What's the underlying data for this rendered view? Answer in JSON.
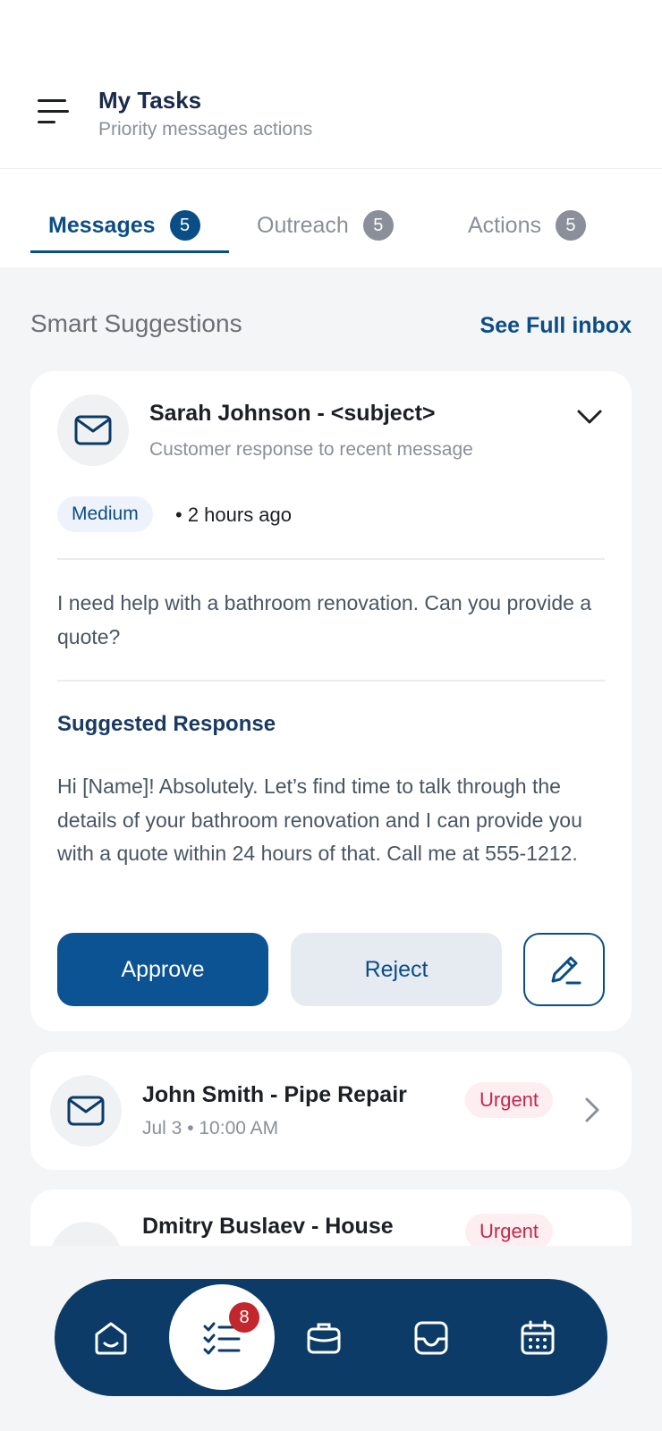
{
  "header": {
    "title": "My Tasks",
    "subtitle": "Priority messages actions",
    "menu_icon": "hamburger-menu-icon"
  },
  "tabs": [
    {
      "label": "Messages",
      "count": "5",
      "active": true
    },
    {
      "label": "Outreach",
      "count": "5",
      "active": false
    },
    {
      "label": "Actions",
      "count": "5",
      "active": false
    }
  ],
  "suggestions": {
    "title": "Smart Suggestions",
    "see_full_label": "See Full inbox"
  },
  "main_card": {
    "icon": "mail-icon",
    "sender_subject": "Sarah Johnson - <subject>",
    "preview": "Customer response to recent message",
    "priority": "Medium",
    "time_ago": "• 2 hours ago",
    "message": "I need help with a bathroom renovation.  Can you provide a quote?",
    "suggested_title": "Suggested Response",
    "suggested_response": "Hi [Name]! Absolutely.  Let’s find time to talk through the details of your bathroom renovation and I can provide you with a quote within 24 hours of that.  Call me at 555-1212.",
    "approve_label": "Approve",
    "reject_label": "Reject",
    "edit_icon": "pencil-icon"
  },
  "messages": [
    {
      "title": "John Smith - Pipe Repair",
      "subtitle": "Jul 3 • 10:00 AM",
      "priority": "Urgent"
    },
    {
      "title": "Dmitry Buslaev - House",
      "subtitle": "",
      "priority": "Urgent"
    }
  ],
  "bottom_nav": {
    "items": [
      "home-icon",
      "tasks-icon",
      "briefcase-icon",
      "inbox-icon",
      "calendar-icon"
    ],
    "active": "tasks-icon",
    "tasks_badge": "8"
  },
  "colors": {
    "primary": "#0b4d86",
    "nav_background": "#0b3b66",
    "urgent": "#c8254a",
    "badge_red": "#c1272d"
  }
}
